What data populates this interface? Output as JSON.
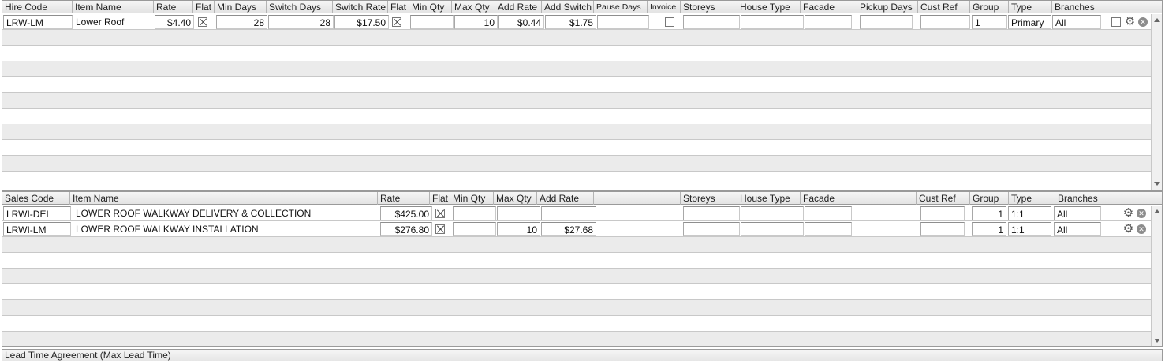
{
  "hire": {
    "columns": [
      "Hire Code",
      "Item Name",
      "Rate",
      "Flat",
      "Min Days",
      "Switch Days",
      "Switch Rate",
      "Flat",
      "Min Qty",
      "Max Qty",
      "Add Rate",
      "Add Switch",
      "Pause Days",
      "Invoice",
      "Storeys",
      "House Type",
      "Facade",
      "Pickup Days",
      "Cust Ref",
      "Group",
      "Type",
      "Branches"
    ],
    "row": {
      "code": "LRW-LM",
      "name": "Lower Roof",
      "rate": "$4.40",
      "flat": true,
      "min_days": "28",
      "switch_days": "28",
      "switch_rate": "$17.50",
      "flat2": true,
      "min_qty": "",
      "max_qty": "10",
      "add_rate": "$0.44",
      "add_switch": "$1.75",
      "pause_days": "",
      "invoice": false,
      "storeys": "",
      "house_type": "",
      "facade": "",
      "pickup_days": "",
      "cust_ref": "",
      "group": "1",
      "type": "Primary",
      "branches": "All",
      "selected": false
    }
  },
  "sales": {
    "columns": [
      "Sales Code",
      "Item Name",
      "Rate",
      "Flat",
      "Min Qty",
      "Max Qty",
      "Add Rate",
      "Storeys",
      "House Type",
      "Facade",
      "Cust Ref",
      "Group",
      "Type",
      "Branches"
    ],
    "rows": [
      {
        "code": "LRWI-DEL",
        "name": "LOWER ROOF WALKWAY DELIVERY & COLLECTION",
        "rate": "$425.00",
        "flat": true,
        "min_qty": "",
        "max_qty": "",
        "add_rate": "",
        "storeys": "",
        "house_type": "",
        "facade": "",
        "cust_ref": "",
        "group": "1",
        "type": "1:1",
        "branches": "All"
      },
      {
        "code": "LRWI-LM",
        "name": "LOWER ROOF WALKWAY INSTALLATION",
        "rate": "$276.80",
        "flat": true,
        "min_qty": "",
        "max_qty": "10",
        "add_rate": "$27.68",
        "storeys": "",
        "house_type": "",
        "facade": "",
        "cust_ref": "",
        "group": "1",
        "type": "1:1",
        "branches": "All"
      }
    ]
  },
  "lead_time_label": "Lead Time Agreement (Max Lead Time)",
  "icons": {
    "settings": "gear-icon",
    "remove": "close-circle-icon"
  }
}
